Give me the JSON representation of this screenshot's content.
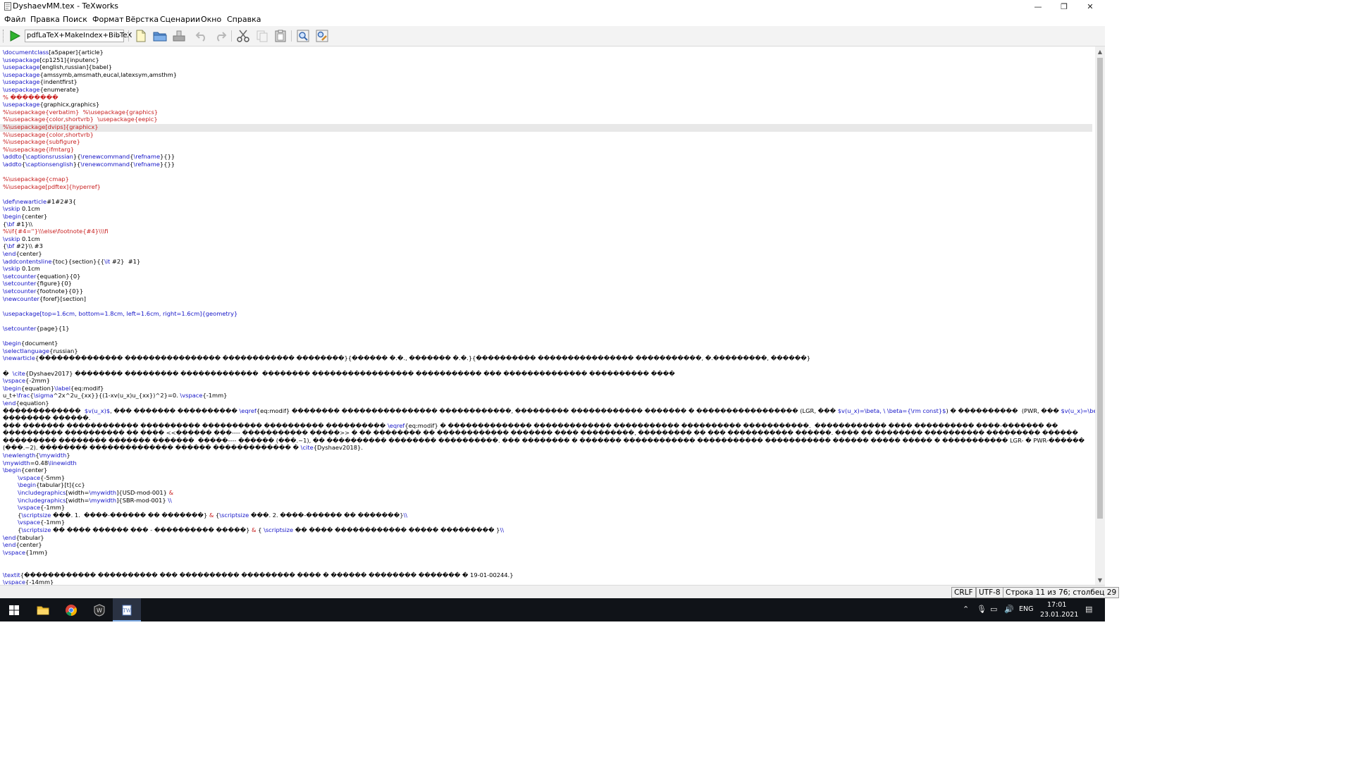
{
  "window": {
    "title": "DyshaevMM.tex - TeXworks",
    "minimize_glyph": "—",
    "maximize_glyph": "❐",
    "close_glyph": "✕"
  },
  "menu": [
    "Файл",
    "Правка",
    "Поиск",
    "Формат",
    "Вёрстка",
    "Сценарии",
    "Окно",
    "Справка"
  ],
  "toolbar": {
    "engine": "pdfLaTeX+MakeIndex+BibTeX",
    "icons": [
      "typeset-play-icon",
      "new-document-icon",
      "open-folder-icon",
      "save-icon",
      "undo-icon",
      "redo-icon",
      "cut-icon",
      "copy-icon",
      "paste-icon",
      "find-icon",
      "replace-icon"
    ]
  },
  "editor": {
    "lines": [
      [
        [
          "c",
          "\\documentclass"
        ],
        [
          "t",
          "[a5paper]{article}"
        ]
      ],
      [
        [
          "c",
          "\\usepackage"
        ],
        [
          "t",
          "[cp1251]{inputenc}"
        ]
      ],
      [
        [
          "c",
          "\\usepackage"
        ],
        [
          "t",
          "[english,russian]{babel}"
        ]
      ],
      [
        [
          "c",
          "\\usepackage"
        ],
        [
          "t",
          "{amssymb,amsmath,eucal,latexsym,amsthm}"
        ]
      ],
      [
        [
          "c",
          "\\usepackage"
        ],
        [
          "t",
          "{indentfirst}"
        ]
      ],
      [
        [
          "c",
          "\\usepackage"
        ],
        [
          "t",
          "{enumerate}"
        ]
      ],
      [
        [
          "r",
          "% ��������"
        ]
      ],
      [
        [
          "c",
          "\\usepackage"
        ],
        [
          "t",
          "{graphicx,graphics}"
        ]
      ],
      [
        [
          "r",
          "%\\usepackage{verbatim}  %\\usepackage{graphics}"
        ]
      ],
      [
        [
          "r",
          "%\\usepackage{color,shortvrb}  \\usepackage{eepic}"
        ]
      ],
      [
        [
          "r",
          "%\\usepackage[dvips]{graphicx}"
        ]
      ],
      [
        [
          "r",
          "%\\usepackage{color,shortvrb}"
        ]
      ],
      [
        [
          "r",
          "%\\usepackage{subfigure}"
        ]
      ],
      [
        [
          "r",
          "%\\usepackage{ifmtarg}"
        ]
      ],
      [
        [
          "c",
          "\\addto"
        ],
        [
          "t",
          "{"
        ],
        [
          "c",
          "\\captionsrussian"
        ],
        [
          "t",
          "}{"
        ],
        [
          "c",
          "\\renewcommand"
        ],
        [
          "t",
          "{"
        ],
        [
          "c",
          "\\refname"
        ],
        [
          "t",
          "}{}}"
        ]
      ],
      [
        [
          "c",
          "\\addto"
        ],
        [
          "t",
          "{"
        ],
        [
          "c",
          "\\captionsenglish"
        ],
        [
          "t",
          "}{"
        ],
        [
          "c",
          "\\renewcommand"
        ],
        [
          "t",
          "{"
        ],
        [
          "c",
          "\\refname"
        ],
        [
          "t",
          "}{}}"
        ]
      ],
      [],
      [
        [
          "r",
          "%\\usepackage{cmap}"
        ]
      ],
      [
        [
          "r",
          "%\\usepackage[pdftex]{hyperref}"
        ]
      ],
      [],
      [
        [
          "c",
          "\\def\\newarticle"
        ],
        [
          "t",
          "#1#2#3{"
        ]
      ],
      [
        [
          "c",
          "\\vskip"
        ],
        [
          "t",
          " 0.1cm"
        ]
      ],
      [
        [
          "c",
          "\\begin"
        ],
        [
          "t",
          "{center}"
        ]
      ],
      [
        [
          "t",
          "{"
        ],
        [
          "c",
          "\\bf"
        ],
        [
          "t",
          " #1}\\\\"
        ]
      ],
      [
        [
          "r",
          "%\\if{#4=''}\\\\\\else\\footnote{#4}\\\\\\fi"
        ]
      ],
      [
        [
          "c",
          "\\vskip"
        ],
        [
          "t",
          " 0.1cm"
        ]
      ],
      [
        [
          "t",
          "{"
        ],
        [
          "c",
          "\\bf"
        ],
        [
          "t",
          " #2}\\\\ #3"
        ]
      ],
      [
        [
          "c",
          "\\end"
        ],
        [
          "t",
          "{center}"
        ]
      ],
      [
        [
          "c",
          "\\addcontentsline"
        ],
        [
          "t",
          "{toc}{section}{{"
        ],
        [
          "c",
          "\\it"
        ],
        [
          "t",
          " #2}  #1}"
        ]
      ],
      [
        [
          "c",
          "\\vskip"
        ],
        [
          "t",
          " 0.1cm"
        ]
      ],
      [
        [
          "c",
          "\\setcounter"
        ],
        [
          "t",
          "{equation}{0}"
        ]
      ],
      [
        [
          "c",
          "\\setcounter"
        ],
        [
          "t",
          "{figure}{0}"
        ]
      ],
      [
        [
          "c",
          "\\setcounter"
        ],
        [
          "t",
          "{footnote}{0}}"
        ]
      ],
      [
        [
          "c",
          "\\newcounter"
        ],
        [
          "t",
          "{foref}[section]"
        ]
      ],
      [],
      [
        [
          "c",
          "\\usepackage"
        ],
        [
          "c",
          "[top=1.6cm, bottom=1.8cm, left=1.6cm, right=1.6cm]{geometry}"
        ]
      ],
      [],
      [
        [
          "c",
          "\\setcounter"
        ],
        [
          "t",
          "{page}{1}"
        ]
      ],
      [],
      [
        [
          "c",
          "\\begin"
        ],
        [
          "t",
          "{document}"
        ]
      ],
      [
        [
          "c",
          "\\selectlanguage"
        ],
        [
          "t",
          "{russian}"
        ]
      ],
      [
        [
          "c",
          "\\newarticle"
        ],
        [
          "t",
          "{�������������� ���������������� ������������ ��������}{������ �.�., ������� �.�.}{���������� ���������������� �����������, �.���������, ������}"
        ]
      ],
      [],
      [
        [
          "t",
          "�  "
        ],
        [
          "c",
          "\\cite"
        ],
        [
          "t",
          "{Dyshaev2017} �������� ��������� �������������  �������� ����������������� ����������� ��� �������������� ���������� ����"
        ]
      ],
      [
        [
          "c",
          "\\vspace"
        ],
        [
          "t",
          "{-2mm}"
        ]
      ],
      [
        [
          "c",
          "\\begin"
        ],
        [
          "t",
          "{equation}"
        ],
        [
          "c",
          "\\label"
        ],
        [
          "t",
          "{eq:modif}"
        ]
      ],
      [
        [
          "t",
          "u_t+"
        ],
        [
          "c",
          "\\frac"
        ],
        [
          "t",
          "{"
        ],
        [
          "c",
          "\\sigma"
        ],
        [
          "t",
          "^2x^2u_{xx}}{(1-xv(u_x)u_{xx})^2}=0. "
        ],
        [
          "c",
          "\\vspace"
        ],
        [
          "t",
          "{-1mm}"
        ]
      ],
      [
        [
          "c",
          "\\end"
        ],
        [
          "t",
          "{equation}"
        ]
      ],
      [
        [
          "t",
          "�������������  "
        ],
        [
          "c",
          "$v(u_x)$"
        ],
        [
          "t",
          ", ��� ������� ���������� "
        ],
        [
          "c",
          "\\eqref"
        ],
        [
          "t",
          "{eq:modif} �������� ���������������� ������������, ��������� ������������ ������� � ����������������� (LGR, ��� "
        ],
        [
          "c",
          "$v(u_x)=\\beta, \\ \\beta={\\rm const}$"
        ],
        [
          "t",
          ") � ����������  (PWR, ��� "
        ],
        [
          "c",
          "$v(u_x)=\\beta/u_x$"
        ],
        [
          "t",
          ")"
        ]
      ],
      [
        [
          "t",
          "�������� ������."
        ]
      ],
      [
        [
          "t",
          "��� ������� ������������ ���������� ���������� ���������� ���������� "
        ],
        [
          "c",
          "\\eqref"
        ],
        [
          "t",
          "{eq:modif} � �������������� ������������� ����������� ���������� �����������.  ������������ ���� ���������� ����-������� ��"
        ]
      ],
      [
        [
          "t",
          "���������� ���������� �� ���� <<������ ���---- ����������� �����>> � �� �������� �� ������������ ������� ���� ���������, ��������� �� ��� ����������� ������. ���� �� �������� ���������� ��������� ������"
        ]
      ],
      [
        [
          "t",
          "��������� �������� ������� �������  �����---- ������ (���.~1), �� ���������� �������� ����������. ��� �������� � ������� ������������ ����������� ����������� ������ ����� ����� � ����������� LGR- � PWR-������"
        ]
      ],
      [
        [
          "t",
          "(���.~2). �������� �������������� ������ ������������� � "
        ],
        [
          "c",
          "\\cite"
        ],
        [
          "t",
          "{Dyshaev2018}."
        ]
      ],
      [
        [
          "c",
          "\\newlength"
        ],
        [
          "t",
          "{"
        ],
        [
          "c",
          "\\mywidth"
        ],
        [
          "t",
          "}"
        ]
      ],
      [
        [
          "c",
          "\\mywidth"
        ],
        [
          "t",
          "=0.48"
        ],
        [
          "c",
          "\\linewidth"
        ]
      ],
      [
        [
          "c",
          "\\begin"
        ],
        [
          "t",
          "{center}"
        ]
      ],
      [
        [
          "t",
          "\t"
        ],
        [
          "c",
          "\\vspace"
        ],
        [
          "t",
          "{-5mm}"
        ]
      ],
      [
        [
          "t",
          "\t"
        ],
        [
          "c",
          "\\begin"
        ],
        [
          "t",
          "{tabular}[t]{cc}"
        ]
      ],
      [
        [
          "t",
          "\t"
        ],
        [
          "c",
          "\\includegraphics"
        ],
        [
          "t",
          "[width="
        ],
        [
          "c",
          "\\mywidth"
        ],
        [
          "t",
          "]{USD-mod-001} "
        ],
        [
          "r",
          "&"
        ]
      ],
      [
        [
          "t",
          "\t"
        ],
        [
          "c",
          "\\includegraphics"
        ],
        [
          "t",
          "[width="
        ],
        [
          "c",
          "\\mywidth"
        ],
        [
          "t",
          "]{SBR-mod-001} "
        ],
        [
          "c",
          "\\\\"
        ]
      ],
      [
        [
          "t",
          "\t"
        ],
        [
          "c",
          "\\vspace"
        ],
        [
          "t",
          "{-1mm}"
        ]
      ],
      [
        [
          "t",
          "\t{"
        ],
        [
          "c",
          "\\scriptsize"
        ],
        [
          "t",
          " ���. 1.  ����-������ �� �������} "
        ],
        [
          "r",
          "&"
        ],
        [
          "t",
          " {"
        ],
        [
          "c",
          "\\scriptsize"
        ],
        [
          "t",
          " ���. 2. ����-������ �� �������}"
        ],
        [
          "c",
          "\\\\"
        ]
      ],
      [
        [
          "t",
          "\t"
        ],
        [
          "c",
          "\\vspace"
        ],
        [
          "t",
          "{-1mm}"
        ]
      ],
      [
        [
          "t",
          "\t{"
        ],
        [
          "c",
          "\\scriptsize"
        ],
        [
          "t",
          " �� ���� ������ ��� - ���������� �����} "
        ],
        [
          "r",
          "&"
        ],
        [
          "t",
          " { "
        ],
        [
          "c",
          "\\scriptsize"
        ],
        [
          "t",
          " �� ���� ������������ ����� ��������� }"
        ],
        [
          "c",
          "\\\\"
        ]
      ],
      [
        [
          "c",
          "\\end"
        ],
        [
          "t",
          "{tabular}"
        ]
      ],
      [
        [
          "c",
          "\\end"
        ],
        [
          "t",
          "{center}"
        ]
      ],
      [
        [
          "c",
          "\\vspace"
        ],
        [
          "t",
          "{1mm}"
        ]
      ],
      [],
      [],
      [
        [
          "c",
          "\\textit"
        ],
        [
          "t",
          "{������������ ���������� ��� ���������� ��������� ���� � ������ �������� ������� � 19-01-00244.}"
        ]
      ],
      [
        [
          "c",
          "\\vspace"
        ],
        [
          "t",
          "{-14mm}"
        ]
      ]
    ]
  },
  "status": {
    "line_ending": "CRLF",
    "encoding": "UTF-8",
    "position": "Строка 11 из 76; столбец 29"
  },
  "taskbar": {
    "apps": [
      "start-icon",
      "file-explorer-icon",
      "chrome-icon",
      "tanks-game-icon",
      "texworks-icon"
    ],
    "lang": "ENG",
    "time": "17:01",
    "date": "23.01.2021"
  },
  "colors": {
    "command": "#1515c8",
    "comment": "#c81e1e",
    "text": "#000000",
    "current_line": "#e8e8e8"
  }
}
